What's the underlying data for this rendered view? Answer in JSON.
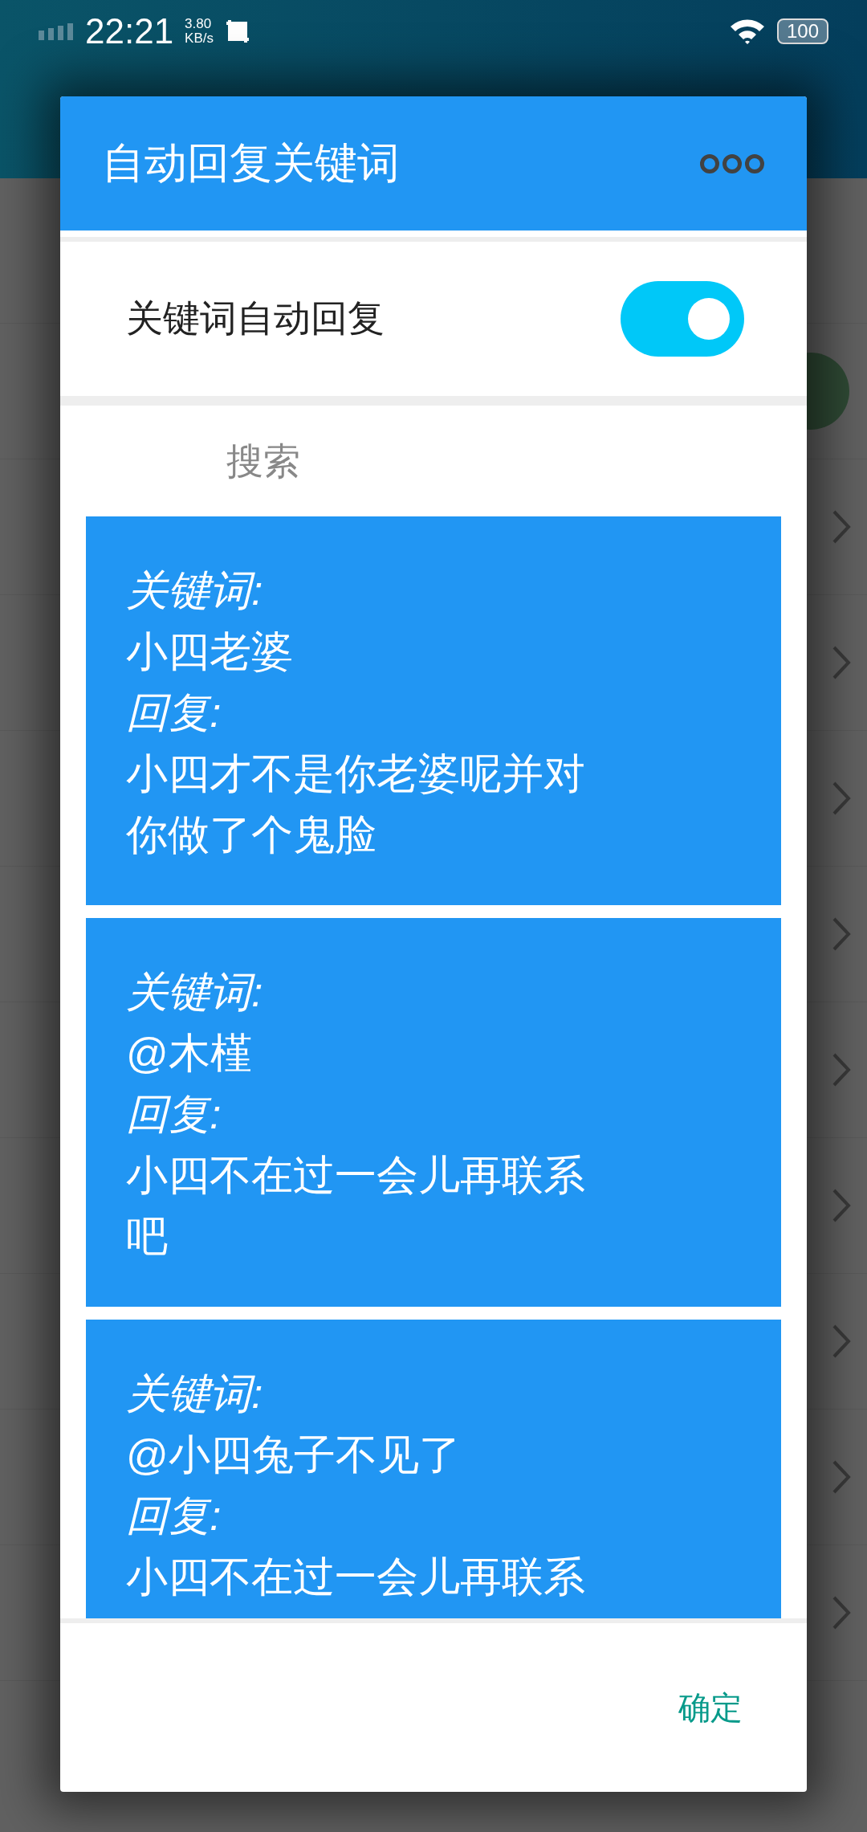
{
  "status_bar": {
    "time": "22:21",
    "speed_value": "3.80",
    "speed_unit": "KB/s",
    "battery": "100"
  },
  "dialog": {
    "title": "自动回复关键词",
    "switch": {
      "label": "关键词自动回复",
      "on": true
    },
    "search": {
      "placeholder": "搜索"
    },
    "rules": [
      {
        "keyword_label": "关键词:",
        "keyword": "小四老婆",
        "reply_label": "回复:",
        "reply": "小四才不是你老婆呢并对你做了个鬼脸"
      },
      {
        "keyword_label": "关键词:",
        "keyword": "@木槿",
        "reply_label": "回复:",
        "reply": "小四不在过一会儿再联系吧"
      },
      {
        "keyword_label": "关键词:",
        "keyword": "@小四兔子不见了",
        "reply_label": "回复:",
        "reply": "小四不在过一会儿再联系"
      }
    ],
    "buttons": [
      "确定"
    ]
  }
}
